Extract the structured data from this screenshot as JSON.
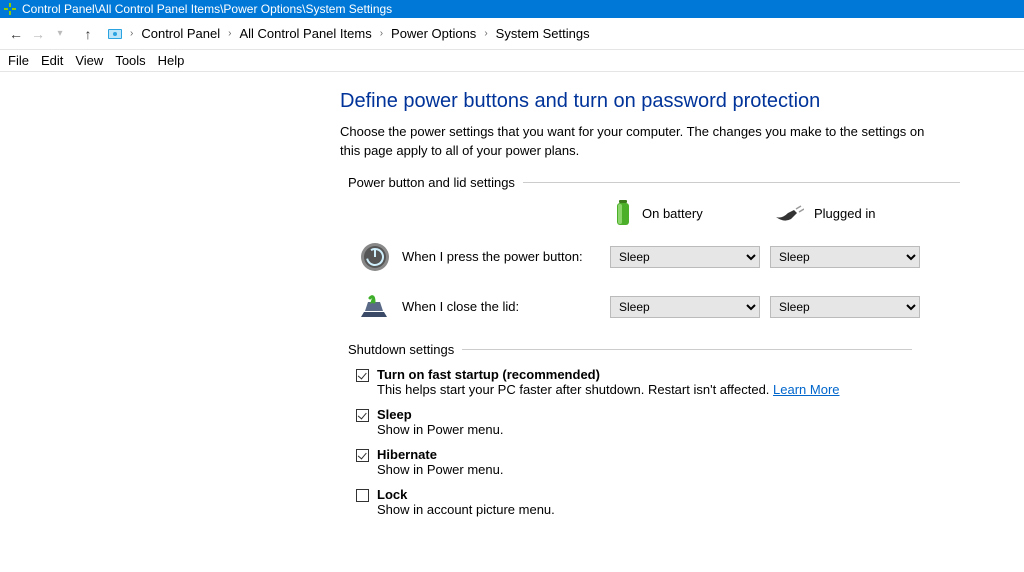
{
  "titlebar": {
    "path": "Control Panel\\All Control Panel Items\\Power Options\\System Settings"
  },
  "breadcrumb": {
    "items": [
      "Control Panel",
      "All Control Panel Items",
      "Power Options",
      "System Settings"
    ]
  },
  "menu": {
    "file": "File",
    "edit": "Edit",
    "view": "View",
    "tools": "Tools",
    "help": "Help"
  },
  "page": {
    "title": "Define power buttons and turn on password protection",
    "subtitle": "Choose the power settings that you want for your computer. The changes you make to the settings on this page apply to all of your power plans."
  },
  "power_section": {
    "label": "Power button and lid settings",
    "col_battery": "On battery",
    "col_plugged": "Plugged in",
    "rows": [
      {
        "label": "When I press the power button:",
        "battery": "Sleep",
        "plugged": "Sleep"
      },
      {
        "label": "When I close the lid:",
        "battery": "Sleep",
        "plugged": "Sleep"
      }
    ]
  },
  "shutdown_section": {
    "label": "Shutdown settings",
    "items": [
      {
        "title": "Turn on fast startup (recommended)",
        "desc": "This helps start your PC faster after shutdown. Restart isn't affected. ",
        "checked": true,
        "learn_more": "Learn More"
      },
      {
        "title": "Sleep",
        "desc": "Show in Power menu.",
        "checked": true
      },
      {
        "title": "Hibernate",
        "desc": "Show in Power menu.",
        "checked": true
      },
      {
        "title": "Lock",
        "desc": "Show in account picture menu.",
        "checked": false
      }
    ]
  }
}
